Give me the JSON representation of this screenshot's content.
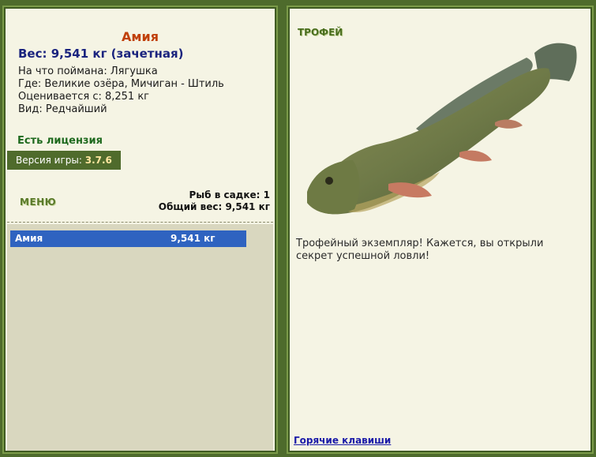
{
  "fish": {
    "name": "Амия",
    "weight": "Вес: 9,541 кг (зачетная)",
    "bait": "На что поймана: Лягушка",
    "location": "Где: Великие озёра, Мичиган - Штиль",
    "valued": "Оценивается с: 8,251 кг",
    "rarity": "Вид: Редчайший"
  },
  "license": "Есть лицензия",
  "version": {
    "label": "Версия игры:",
    "value": "3.7.6"
  },
  "menu": "МЕНЮ",
  "stats": {
    "count": "Рыб в садке: 1",
    "total": "Общий вес: 9,541 кг"
  },
  "keepnet": [
    {
      "name": "Амия",
      "weight": "9,541 кг"
    }
  ],
  "trophy": {
    "label": "ТРОФЕЙ",
    "text": "Трофейный экземпляр! Кажется, вы открыли секрет успешной ловли!"
  },
  "hotkeys": "Горячие клавиши",
  "colors": {
    "frame": "#4e6b2c",
    "panel": "#f5f4e4",
    "fish_name": "#c0400a",
    "weight": "#1a237e",
    "license": "#1f6a1f",
    "selected_row": "#2f63c0",
    "keepnet_bg": "#d9d7bf"
  },
  "icons": {
    "fish_image": "bowfin-fish-picture"
  }
}
